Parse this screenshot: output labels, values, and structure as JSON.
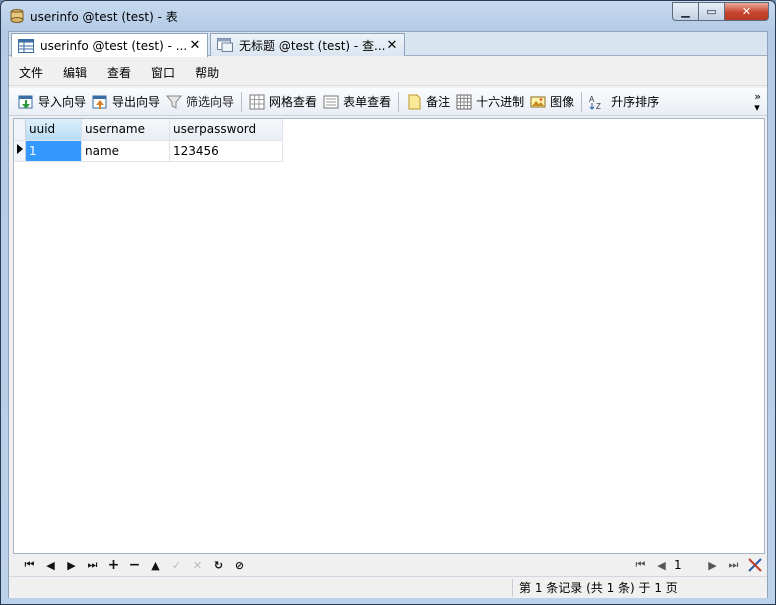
{
  "window": {
    "title": "userinfo @test (test) - 表"
  },
  "tabs": [
    {
      "label": "userinfo @test (test) - ...",
      "active": true
    },
    {
      "label": "无标题 @test (test) - 查...",
      "active": false
    }
  ],
  "menu": [
    "文件",
    "编辑",
    "查看",
    "窗口",
    "帮助"
  ],
  "toolbar": {
    "import_wizard": "导入向导",
    "export_wizard": "导出向导",
    "filter_wizard": "筛选向导",
    "grid_view": "网格查看",
    "form_view": "表单查看",
    "memo": "备注",
    "hex": "十六进制",
    "image": "图像",
    "sort_asc": "升序排序",
    "more": "»"
  },
  "grid": {
    "columns": [
      "uuid",
      "username",
      "userpassword"
    ],
    "rows": [
      [
        "1",
        "name",
        "123456"
      ]
    ]
  },
  "navigator": {
    "page_value": "1"
  },
  "status": {
    "record_info": "第 1 条记录 (共 1 条) 于 1 页"
  },
  "colors": {
    "accent": "#3399ff",
    "close_button": "#c7452e"
  }
}
